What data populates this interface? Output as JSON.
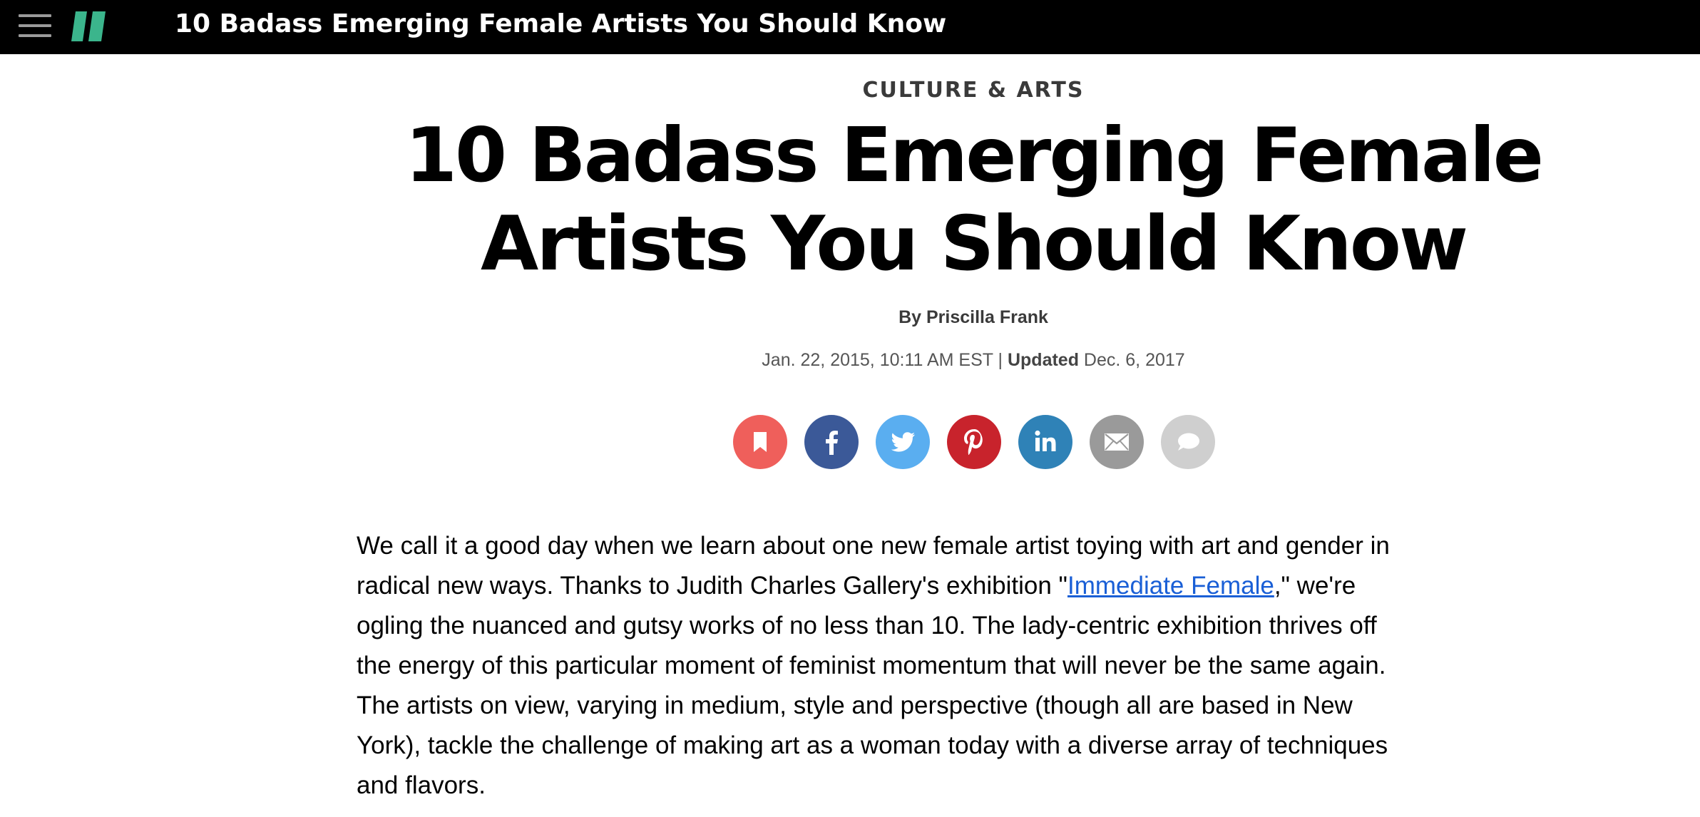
{
  "topbar": {
    "title": "10 Badass Emerging Female Artists You Should Know",
    "menu_icon": "hamburger-menu-icon",
    "logo_icon": "huffpost-logo-icon",
    "logo_color": "#3bb58c"
  },
  "article": {
    "section": "CULTURE & ARTS",
    "headline": "10 Badass Emerging Female Artists You Should Know",
    "byline_prefix": "By ",
    "author": "Priscilla Frank",
    "published": "Jan. 22, 2015, 10:11 AM EST",
    "separator": " | ",
    "updated_label": "Updated",
    "updated_date": " Dec. 6, 2017",
    "body": {
      "part1": "We call it a good day when we learn about one new female artist toying with art and gender in radical new ways. Thanks to Judith Charles Gallery's exhibition \"",
      "link_text": "Immediate Female",
      "part2": ",\" we're ogling the nuanced and gutsy works of no less than 10. The lady-centric exhibition thrives off the energy of this particular moment of feminist momentum that will never be the same again. The artists on view, varying in medium, style and perspective (though all are based in New York), tackle the challenge of making art as a woman today with a diverse array of techniques and flavors."
    }
  },
  "share_buttons": [
    {
      "name": "bookmark",
      "icon": "bookmark-icon",
      "color": "#ef5f5b"
    },
    {
      "name": "facebook",
      "icon": "facebook-icon",
      "color": "#3b5998"
    },
    {
      "name": "twitter",
      "icon": "twitter-icon",
      "color": "#5aaef0"
    },
    {
      "name": "pinterest",
      "icon": "pinterest-icon",
      "color": "#c8232c"
    },
    {
      "name": "linkedin",
      "icon": "linkedin-icon",
      "color": "#2f82b7"
    },
    {
      "name": "email",
      "icon": "email-icon",
      "color": "#9a9a9a"
    },
    {
      "name": "comments",
      "icon": "comment-icon",
      "color": "#cfcfcf"
    }
  ]
}
